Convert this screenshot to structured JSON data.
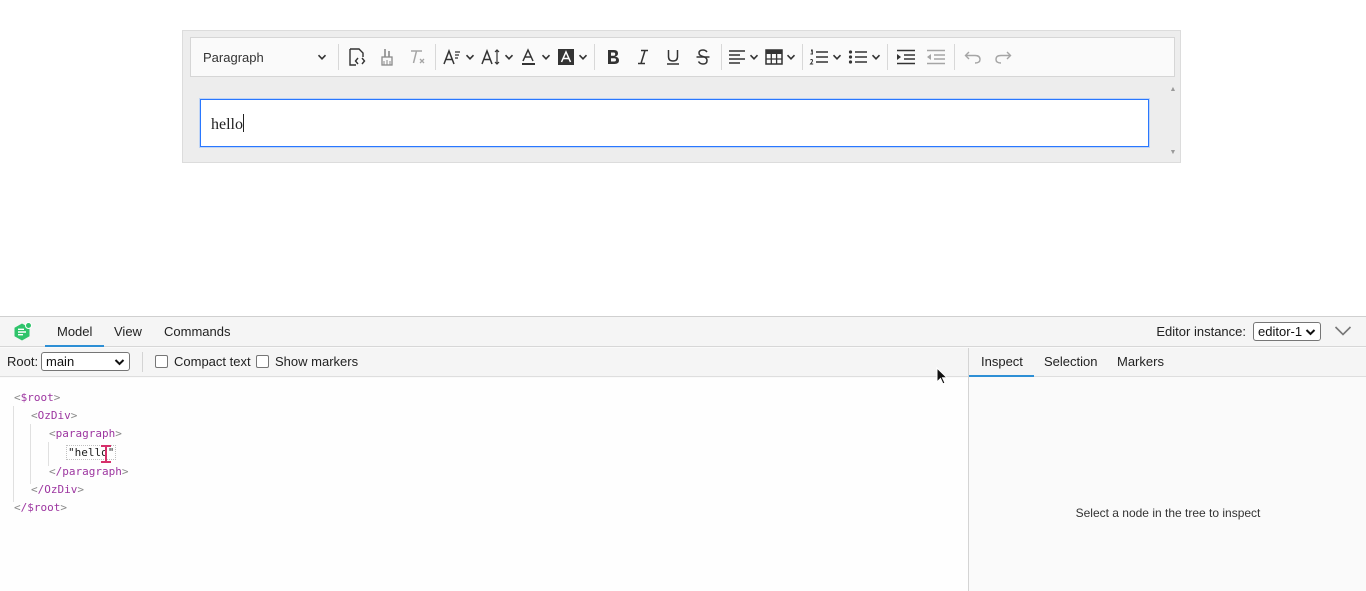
{
  "editor": {
    "heading_select": "Paragraph",
    "content_text": "hello",
    "toolbar": {
      "items": [
        "source-editing",
        "format-painter",
        "remove-format",
        "font-size",
        "line-height",
        "font-color",
        "font-background-color",
        "bold",
        "italic",
        "underline",
        "strikethrough",
        "alignment",
        "insert-table",
        "numbered-list",
        "bulleted-list",
        "indent",
        "outdent",
        "undo",
        "redo"
      ]
    },
    "accent_color": "#2977ff"
  },
  "inspector": {
    "tabs": [
      {
        "label": "Model",
        "active": true
      },
      {
        "label": "View",
        "active": false
      },
      {
        "label": "Commands",
        "active": false
      }
    ],
    "editor_instance_label": "Editor instance:",
    "editor_instance_value": "editor-1",
    "root_label": "Root:",
    "root_value": "main",
    "compact_text_label": "Compact text",
    "show_markers_label": "Show markers",
    "tree": {
      "root_open": "$root",
      "div_open": "OzDiv",
      "paragraph_open": "paragraph",
      "text": "\"hello\"",
      "paragraph_close": "/paragraph",
      "div_close": "/OzDiv",
      "root_close": "/$root"
    },
    "right_tabs": [
      {
        "label": "Inspect",
        "active": true
      },
      {
        "label": "Selection",
        "active": false
      },
      {
        "label": "Markers",
        "active": false
      }
    ],
    "inspect_empty": "Select a node in the tree to inspect",
    "tab_accent": "#2d8fd5",
    "logo_color": "#2fc46b"
  }
}
